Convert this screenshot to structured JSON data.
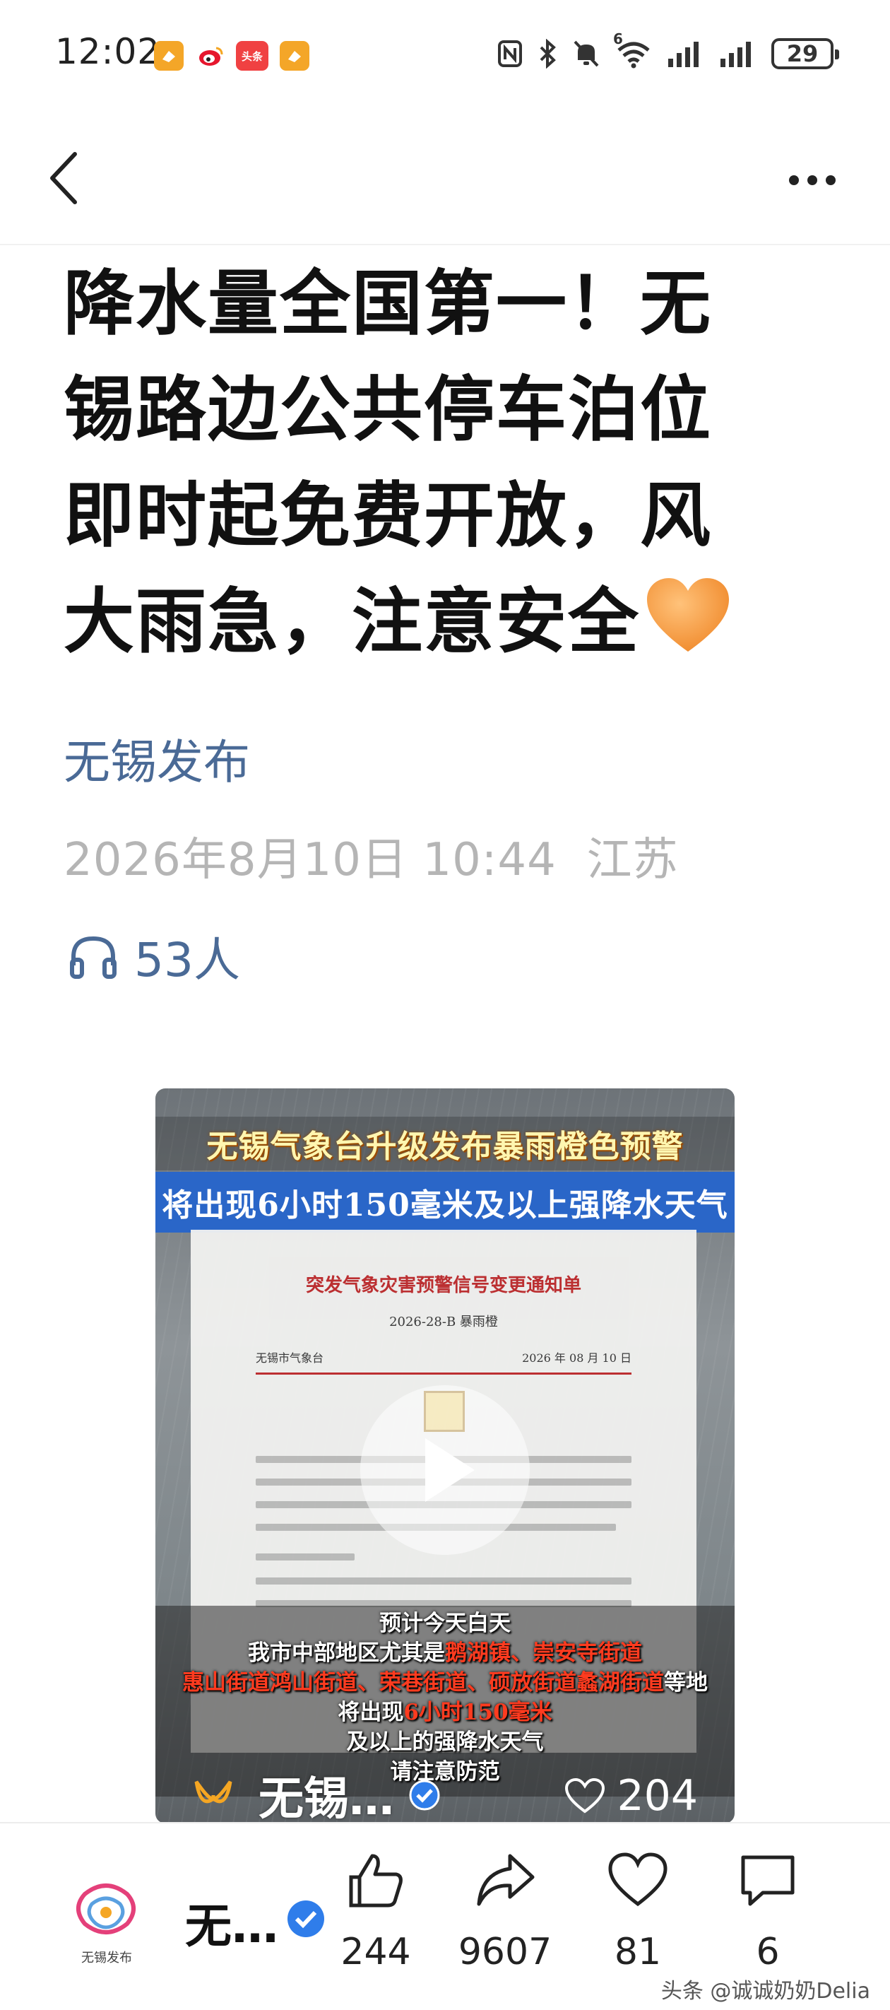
{
  "status_bar": {
    "time": "12:02",
    "notifications": [
      {
        "icon": "orange-app-icon",
        "color": "#f4a628"
      },
      {
        "icon": "weibo-icon",
        "color": "#e6162d"
      },
      {
        "icon": "toutiao-icon",
        "color": "#f04142",
        "text": "头条"
      },
      {
        "icon": "orange-app-icon",
        "color": "#f4a628"
      }
    ],
    "system_icons": [
      "nfc-icon",
      "bluetooth-icon",
      "mute-icon",
      "wifi-icon",
      "signal-icon",
      "signal-icon"
    ],
    "wifi_label": "6",
    "battery": "29"
  },
  "nav": {
    "back_icon": "back-arrow-icon",
    "more_icon": "more-icon"
  },
  "article": {
    "headline_line1": "降水量全国第一！无",
    "headline_line2": "锡路边公共停车泊位",
    "headline_line3": "即时起免费开放，风",
    "headline_line4": "大雨急，注意安全",
    "author": "无锡发布",
    "date": "2026年8月10日 10:44",
    "location": "江苏",
    "listeners": "53人"
  },
  "video": {
    "banner_top": "无锡气象台升级发布暴雨橙色预警",
    "banner_blue": "将出现6小时150毫米及以上强降水天气",
    "doc_title": "突发气象灾害预警信号变更通知单",
    "doc_number": "2026-28-B 暴雨橙",
    "doc_issuer": "无锡市气象台",
    "doc_date": "2026 年 08 月 10 日",
    "caption_line1": "预计今天白天",
    "caption_line2_a": "我市中部地区尤其是",
    "caption_line2_b": "鹅湖镇、崇安寺街道",
    "caption_line3_a": "惠山街道鸿山街道、荣巷街道、硕放街道蠡湖街道",
    "caption_line3_b": "等地",
    "caption_line4_a": "将出现",
    "caption_line4_b": "6小时150毫米",
    "caption_line5": "及以上的强降水天气",
    "caption_line6": "请注意防范",
    "account_name": "无锡…",
    "likes": "204",
    "colors": {
      "highlight": "#ff3b1f",
      "banner_blue": "#2a66c8"
    }
  },
  "bottom_bar": {
    "account_logo_text": "无锡发布",
    "account_name": "无…",
    "thumbs_up_count": "244",
    "share_count": "9607",
    "favorite_count": "81",
    "comment_count": "6",
    "watermark": "头条 @诚诚奶奶Delia"
  },
  "colors": {
    "link_blue": "#4a6a96",
    "meta_gray": "#b5b5b5",
    "verified_blue": "#2f7dea"
  }
}
